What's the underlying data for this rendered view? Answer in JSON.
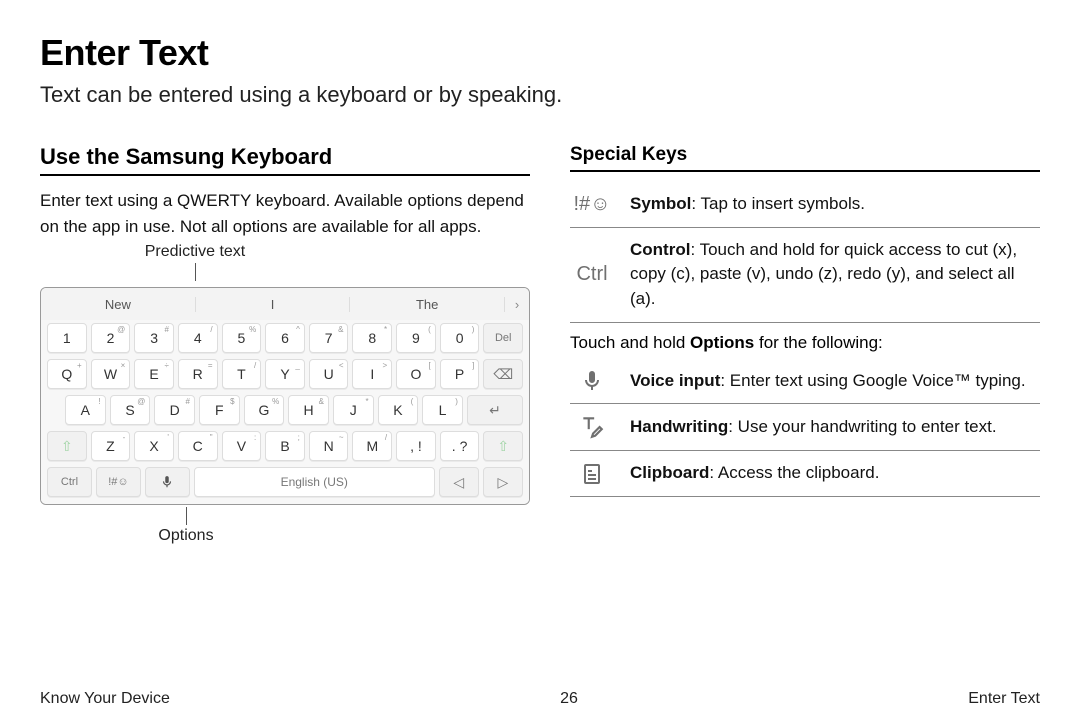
{
  "page": {
    "title": "Enter Text",
    "subtitle": "Text can be entered using a keyboard or by speaking."
  },
  "left": {
    "heading": "Use the Samsung Keyboard",
    "body": "Enter text using a QWERTY keyboard. Available options depend on the app in use. Not all options are available for all apps.",
    "callout_top": "Predictive text",
    "callout_bottom": "Options"
  },
  "keyboard": {
    "predictions": [
      "New",
      "I",
      "The"
    ],
    "row1": [
      {
        "main": "1",
        "sup": ""
      },
      {
        "main": "2",
        "sup": "@"
      },
      {
        "main": "3",
        "sup": "#"
      },
      {
        "main": "4",
        "sup": "/"
      },
      {
        "main": "5",
        "sup": "%"
      },
      {
        "main": "6",
        "sup": "^"
      },
      {
        "main": "7",
        "sup": "&"
      },
      {
        "main": "8",
        "sup": "*"
      },
      {
        "main": "9",
        "sup": "("
      },
      {
        "main": "0",
        "sup": ")"
      }
    ],
    "row1_del": "Del",
    "row2": [
      {
        "main": "Q",
        "sup": "+"
      },
      {
        "main": "W",
        "sup": "×"
      },
      {
        "main": "E",
        "sup": "÷"
      },
      {
        "main": "R",
        "sup": "="
      },
      {
        "main": "T",
        "sup": "/"
      },
      {
        "main": "Y",
        "sup": "_"
      },
      {
        "main": "U",
        "sup": "<"
      },
      {
        "main": "I",
        "sup": ">"
      },
      {
        "main": "O",
        "sup": "["
      },
      {
        "main": "P",
        "sup": "]"
      }
    ],
    "row3": [
      {
        "main": "A",
        "sup": "!"
      },
      {
        "main": "S",
        "sup": "@"
      },
      {
        "main": "D",
        "sup": "#"
      },
      {
        "main": "F",
        "sup": "$"
      },
      {
        "main": "G",
        "sup": "%"
      },
      {
        "main": "H",
        "sup": "&"
      },
      {
        "main": "J",
        "sup": "*"
      },
      {
        "main": "K",
        "sup": "("
      },
      {
        "main": "L",
        "sup": ")"
      }
    ],
    "row4": [
      {
        "main": "Z",
        "sup": "-"
      },
      {
        "main": "X",
        "sup": "'"
      },
      {
        "main": "C",
        "sup": "\""
      },
      {
        "main": "V",
        "sup": ":"
      },
      {
        "main": "B",
        "sup": ";"
      },
      {
        "main": "N",
        "sup": "~"
      },
      {
        "main": "M",
        "sup": "/"
      },
      {
        "main": ", !",
        "sup": ""
      },
      {
        "main": ". ?",
        "sup": ""
      }
    ],
    "bottom": {
      "ctrl": "Ctrl",
      "sym": "!#☺",
      "space": "English (US)"
    }
  },
  "right": {
    "heading": "Special Keys",
    "rows": [
      {
        "icon": "!#☺",
        "bold": "Symbol",
        "text": ": Tap to insert symbols."
      },
      {
        "icon": "Ctrl",
        "bold": "Control",
        "text": ": Touch and hold for quick access to cut (x), copy (c), paste (v), undo (z), redo (y), and select all (a)."
      }
    ],
    "intro": "Touch and hold Options for the following:",
    "intro_bold": "Options",
    "opts": [
      {
        "bold": "Voice input",
        "text": ": Enter text using Google Voice™ typing."
      },
      {
        "bold": "Handwriting",
        "text": ": Use your handwriting to enter text."
      },
      {
        "bold": "Clipboard",
        "text": ": Access the clipboard."
      }
    ]
  },
  "footer": {
    "left": "Know Your Device",
    "center": "26",
    "right": "Enter Text"
  }
}
